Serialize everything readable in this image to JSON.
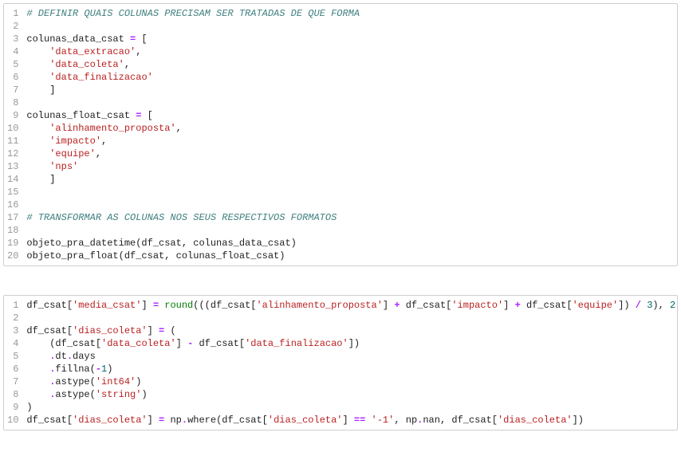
{
  "cell1": {
    "lines": [
      [
        [
          "c-comment",
          "# DEFINIR QUAIS COLUNAS PRECISAM SER TRATADAS DE QUE FORMA"
        ]
      ],
      [],
      [
        [
          "c-ident",
          "colunas_data_csat "
        ],
        [
          "c-op",
          "="
        ],
        [
          "c-ident",
          " ["
        ]
      ],
      [
        [
          "c-ident",
          "    "
        ],
        [
          "c-string",
          "'data_extracao'"
        ],
        [
          "c-punct",
          ","
        ]
      ],
      [
        [
          "c-ident",
          "    "
        ],
        [
          "c-string",
          "'data_coleta'"
        ],
        [
          "c-punct",
          ","
        ]
      ],
      [
        [
          "c-ident",
          "    "
        ],
        [
          "c-string",
          "'data_finalizacao'"
        ]
      ],
      [
        [
          "c-ident",
          "    ]"
        ]
      ],
      [],
      [
        [
          "c-ident",
          "colunas_float_csat "
        ],
        [
          "c-op",
          "="
        ],
        [
          "c-ident",
          " ["
        ]
      ],
      [
        [
          "c-ident",
          "    "
        ],
        [
          "c-string",
          "'alinhamento_proposta'"
        ],
        [
          "c-punct",
          ","
        ]
      ],
      [
        [
          "c-ident",
          "    "
        ],
        [
          "c-string",
          "'impacto'"
        ],
        [
          "c-punct",
          ","
        ]
      ],
      [
        [
          "c-ident",
          "    "
        ],
        [
          "c-string",
          "'equipe'"
        ],
        [
          "c-punct",
          ","
        ]
      ],
      [
        [
          "c-ident",
          "    "
        ],
        [
          "c-string",
          "'nps'"
        ]
      ],
      [
        [
          "c-ident",
          "    ]"
        ]
      ],
      [],
      [],
      [
        [
          "c-comment",
          "# TRANSFORMAR AS COLUNAS NOS SEUS RESPECTIVOS FORMATOS"
        ]
      ],
      [],
      [
        [
          "c-ident",
          "objeto_pra_datetime(df_csat, colunas_data_csat)"
        ]
      ],
      [
        [
          "c-ident",
          "objeto_pra_float(df_csat, colunas_float_csat)"
        ]
      ]
    ]
  },
  "cell2": {
    "lines": [
      [
        [
          "c-ident",
          "df_csat["
        ],
        [
          "c-string",
          "'media_csat'"
        ],
        [
          "c-ident",
          "] "
        ],
        [
          "c-op",
          "="
        ],
        [
          "c-ident",
          " "
        ],
        [
          "c-builtin",
          "round"
        ],
        [
          "c-ident",
          "(((df_csat["
        ],
        [
          "c-string",
          "'alinhamento_proposta'"
        ],
        [
          "c-ident",
          "] "
        ],
        [
          "c-op",
          "+"
        ],
        [
          "c-ident",
          " df_csat["
        ],
        [
          "c-string",
          "'impacto'"
        ],
        [
          "c-ident",
          "] "
        ],
        [
          "c-op",
          "+"
        ],
        [
          "c-ident",
          " df_csat["
        ],
        [
          "c-string",
          "'equipe'"
        ],
        [
          "c-ident",
          "]) "
        ],
        [
          "c-op",
          "/"
        ],
        [
          "c-ident",
          " "
        ],
        [
          "c-number",
          "3"
        ],
        [
          "c-ident",
          "), "
        ],
        [
          "c-number",
          "2"
        ],
        [
          "c-ident",
          ")"
        ]
      ],
      [],
      [
        [
          "c-ident",
          "df_csat["
        ],
        [
          "c-string",
          "'dias_coleta'"
        ],
        [
          "c-ident",
          "] "
        ],
        [
          "c-op",
          "="
        ],
        [
          "c-ident",
          " ("
        ]
      ],
      [
        [
          "c-ident",
          "    (df_csat["
        ],
        [
          "c-string",
          "'data_coleta'"
        ],
        [
          "c-ident",
          "] "
        ],
        [
          "c-op",
          "-"
        ],
        [
          "c-ident",
          " df_csat["
        ],
        [
          "c-string",
          "'data_finalizacao'"
        ],
        [
          "c-ident",
          "])"
        ]
      ],
      [
        [
          "c-ident",
          "    "
        ],
        [
          "c-op",
          "."
        ],
        [
          "c-ident",
          "dt"
        ],
        [
          "c-op",
          "."
        ],
        [
          "c-ident",
          "days"
        ]
      ],
      [
        [
          "c-ident",
          "    "
        ],
        [
          "c-op",
          "."
        ],
        [
          "c-ident",
          "fillna("
        ],
        [
          "c-op",
          "-"
        ],
        [
          "c-number",
          "1"
        ],
        [
          "c-ident",
          ")"
        ]
      ],
      [
        [
          "c-ident",
          "    "
        ],
        [
          "c-op",
          "."
        ],
        [
          "c-ident",
          "astype("
        ],
        [
          "c-string",
          "'int64'"
        ],
        [
          "c-ident",
          ")"
        ]
      ],
      [
        [
          "c-ident",
          "    "
        ],
        [
          "c-op",
          "."
        ],
        [
          "c-ident",
          "astype("
        ],
        [
          "c-string",
          "'string'"
        ],
        [
          "c-ident",
          ")"
        ]
      ],
      [
        [
          "c-ident",
          ")"
        ]
      ],
      [
        [
          "c-ident",
          "df_csat["
        ],
        [
          "c-string",
          "'dias_coleta'"
        ],
        [
          "c-ident",
          "] "
        ],
        [
          "c-op",
          "="
        ],
        [
          "c-ident",
          " np"
        ],
        [
          "c-op",
          "."
        ],
        [
          "c-ident",
          "where(df_csat["
        ],
        [
          "c-string",
          "'dias_coleta'"
        ],
        [
          "c-ident",
          "] "
        ],
        [
          "c-op",
          "=="
        ],
        [
          "c-ident",
          " "
        ],
        [
          "c-string",
          "'-1'"
        ],
        [
          "c-ident",
          ", np"
        ],
        [
          "c-op",
          "."
        ],
        [
          "c-ident",
          "nan, df_csat["
        ],
        [
          "c-string",
          "'dias_coleta'"
        ],
        [
          "c-ident",
          "])"
        ]
      ]
    ]
  }
}
